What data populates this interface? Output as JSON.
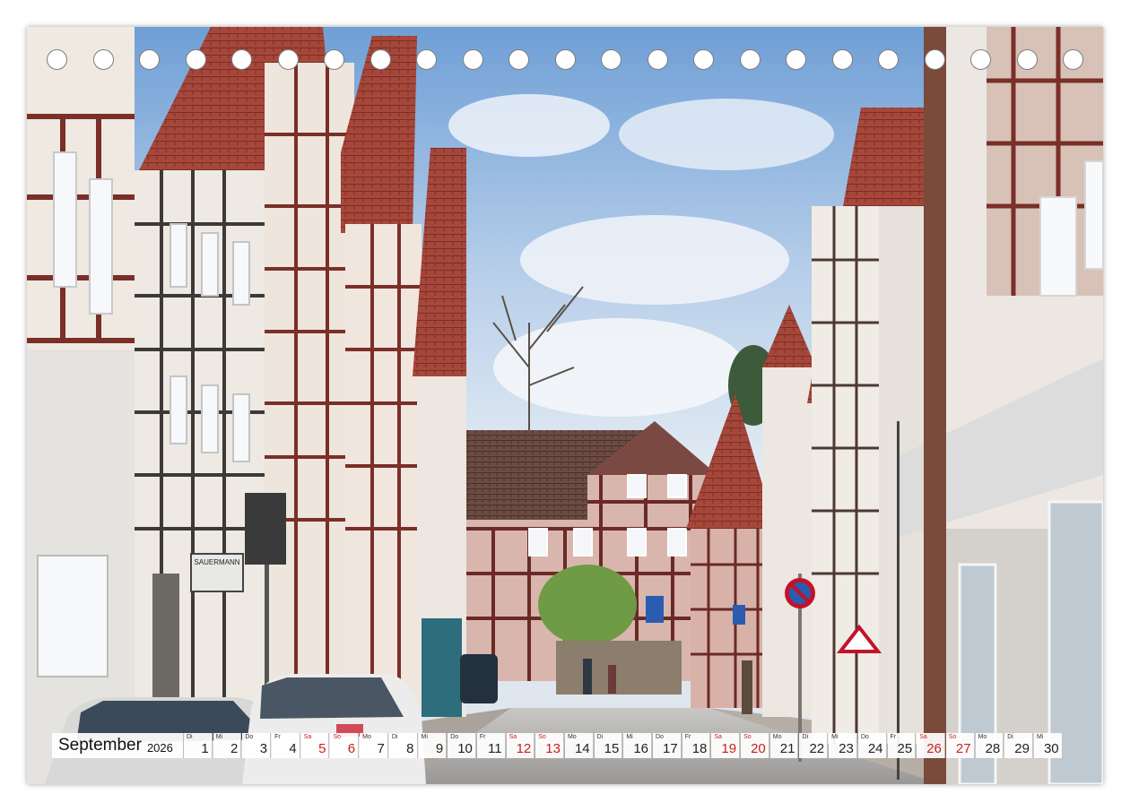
{
  "calendar": {
    "month": "September",
    "year": "2026",
    "days": [
      {
        "wd": "Di",
        "d": "1",
        "we": false
      },
      {
        "wd": "Mi",
        "d": "2",
        "we": false
      },
      {
        "wd": "Do",
        "d": "3",
        "we": false
      },
      {
        "wd": "Fr",
        "d": "4",
        "we": false
      },
      {
        "wd": "Sa",
        "d": "5",
        "we": true
      },
      {
        "wd": "So",
        "d": "6",
        "we": true
      },
      {
        "wd": "Mo",
        "d": "7",
        "we": false
      },
      {
        "wd": "Di",
        "d": "8",
        "we": false
      },
      {
        "wd": "Mi",
        "d": "9",
        "we": false
      },
      {
        "wd": "Do",
        "d": "10",
        "we": false
      },
      {
        "wd": "Fr",
        "d": "11",
        "we": false
      },
      {
        "wd": "Sa",
        "d": "12",
        "we": true
      },
      {
        "wd": "So",
        "d": "13",
        "we": true
      },
      {
        "wd": "Mo",
        "d": "14",
        "we": false
      },
      {
        "wd": "Di",
        "d": "15",
        "we": false
      },
      {
        "wd": "Mi",
        "d": "16",
        "we": false
      },
      {
        "wd": "Do",
        "d": "17",
        "we": false
      },
      {
        "wd": "Fr",
        "d": "18",
        "we": false
      },
      {
        "wd": "Sa",
        "d": "19",
        "we": true
      },
      {
        "wd": "So",
        "d": "20",
        "we": true
      },
      {
        "wd": "Mo",
        "d": "21",
        "we": false
      },
      {
        "wd": "Di",
        "d": "22",
        "we": false
      },
      {
        "wd": "Mi",
        "d": "23",
        "we": false
      },
      {
        "wd": "Do",
        "d": "24",
        "we": false
      },
      {
        "wd": "Fr",
        "d": "25",
        "we": false
      },
      {
        "wd": "Sa",
        "d": "26",
        "we": true
      },
      {
        "wd": "So",
        "d": "27",
        "we": true
      },
      {
        "wd": "Mo",
        "d": "28",
        "we": false
      },
      {
        "wd": "Di",
        "d": "29",
        "we": false
      },
      {
        "wd": "Mi",
        "d": "30",
        "we": false
      }
    ]
  },
  "photo": {
    "shop_sign": "SAUERMANN",
    "colors": {
      "timber": "#7a2f28",
      "roof": "#a5473a",
      "sky": "#8fb4dc",
      "plaster": "#f2ede6"
    }
  }
}
